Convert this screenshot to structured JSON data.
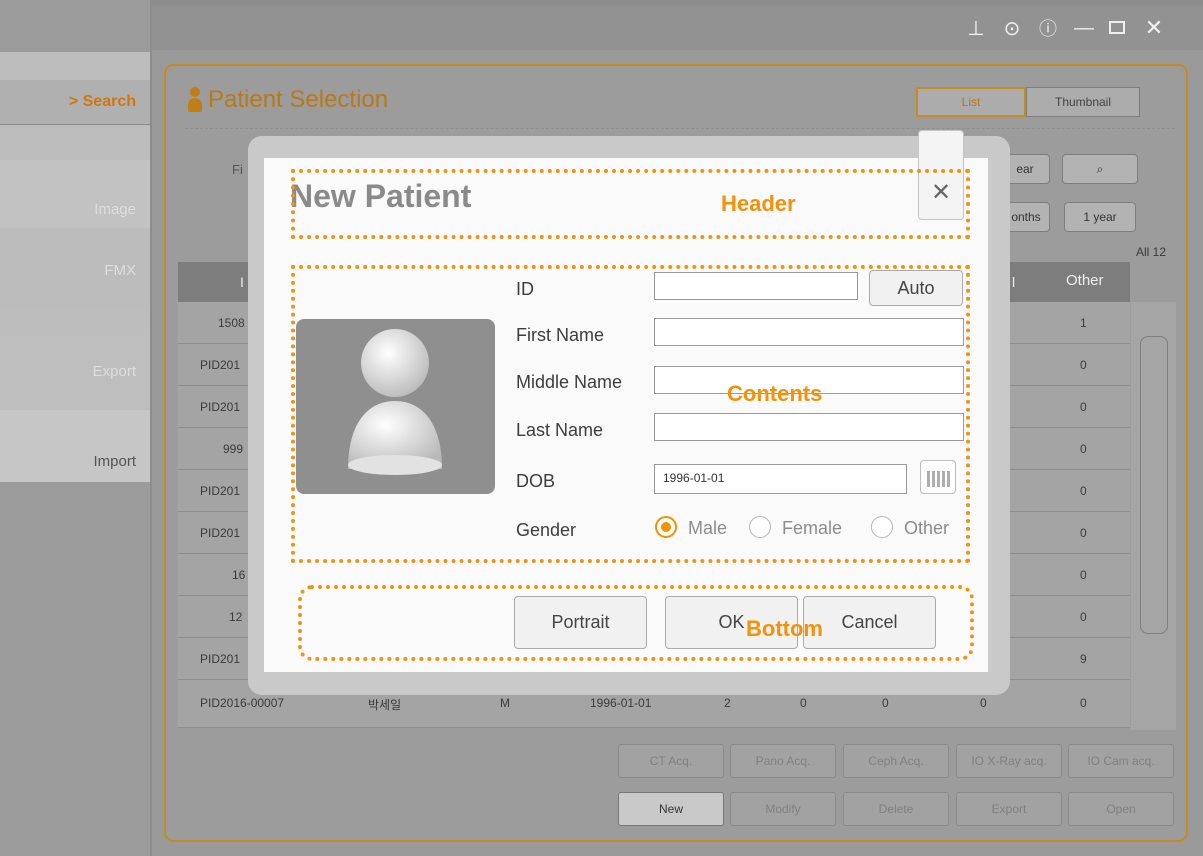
{
  "window_controls": [
    "pin",
    "settings",
    "help",
    "minimize",
    "maximize",
    "close"
  ],
  "sidebar": {
    "items": [
      {
        "label": "> Search",
        "active": true
      },
      {
        "label": "Image",
        "active": false
      },
      {
        "label": "FMX",
        "active": false
      },
      {
        "label": "Export",
        "active": false
      },
      {
        "label": "Import",
        "active": false
      }
    ]
  },
  "header": {
    "title": "Patient Selection",
    "view_list": "List",
    "view_thumbnail": "Thumbnail"
  },
  "filter": {
    "label_fragment": "Fi",
    "btn_year_fragment": "ear",
    "btn_months_fragment": "onths",
    "btn_1year": "1 year",
    "count": "All 12"
  },
  "table": {
    "header_left_fragment": "I",
    "header_mid_fragment": "l",
    "header_other": "Other",
    "rows": [
      {
        "id": "1508",
        "other": "1"
      },
      {
        "id": "PID201",
        "other": "0"
      },
      {
        "id": "PID201",
        "other": "0"
      },
      {
        "id": "999",
        "other": "0"
      },
      {
        "id": "PID201",
        "other": "0"
      },
      {
        "id": "PID201",
        "other": "0"
      },
      {
        "id": "16",
        "other": "0"
      },
      {
        "id": "12",
        "other": "0"
      },
      {
        "id": "PID201",
        "other": "9"
      },
      {
        "id": "PID2016-00007",
        "name": "박세일",
        "gender": "M",
        "dob": "1996-01-01",
        "c1": "2",
        "c2": "0",
        "c3": "0",
        "c4": "0",
        "other": "0"
      }
    ]
  },
  "actions": {
    "row1": [
      "CT Acq.",
      "Pano Acq.",
      "Ceph Acq.",
      "IO X-Ray acq.",
      "IO Cam acq."
    ],
    "row2": [
      "New",
      "Modify",
      "Delete",
      "Export",
      "Open"
    ]
  },
  "dialog": {
    "title": "New Patient",
    "fields": {
      "id": "ID",
      "first_name": "First Name",
      "middle_name": "Middle Name",
      "last_name": "Last Name",
      "dob": "DOB",
      "gender": "Gender"
    },
    "auto_button": "Auto",
    "dob_value": "1996-01-01",
    "gender_options": [
      "Male",
      "Female",
      "Other"
    ],
    "gender_selected": "Male",
    "buttons": {
      "portrait": "Portrait",
      "ok": "OK",
      "cancel": "Cancel"
    }
  },
  "annotations": {
    "header": "Header",
    "contents": "Contents",
    "bottom": "Bottom"
  },
  "colors": {
    "accent": "#f39200",
    "title_brown": "#b87917"
  }
}
